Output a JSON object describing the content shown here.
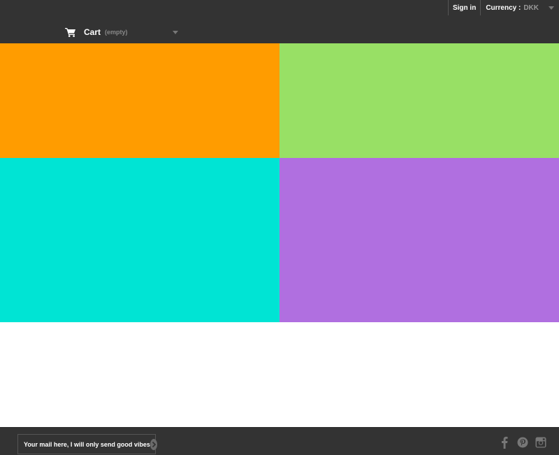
{
  "header": {
    "signin_label": "Sign in",
    "currency_label": "Currency :",
    "currency_value": "DKK",
    "cart_label": "Cart",
    "cart_status": "(empty)"
  },
  "tiles": [
    {
      "color": "#FF9C00"
    },
    {
      "color": "#98E065"
    },
    {
      "color": "#00E4D4"
    },
    {
      "color": "#B06FE0"
    }
  ],
  "footer": {
    "newsletter_placeholder": "Your mail here, I will only send good vibes",
    "social": [
      "facebook-icon",
      "pinterest-icon",
      "instagram-icon"
    ]
  },
  "colors": {
    "header_bg": "#333333",
    "footer_bg": "#333333",
    "muted_text": "#999999"
  }
}
